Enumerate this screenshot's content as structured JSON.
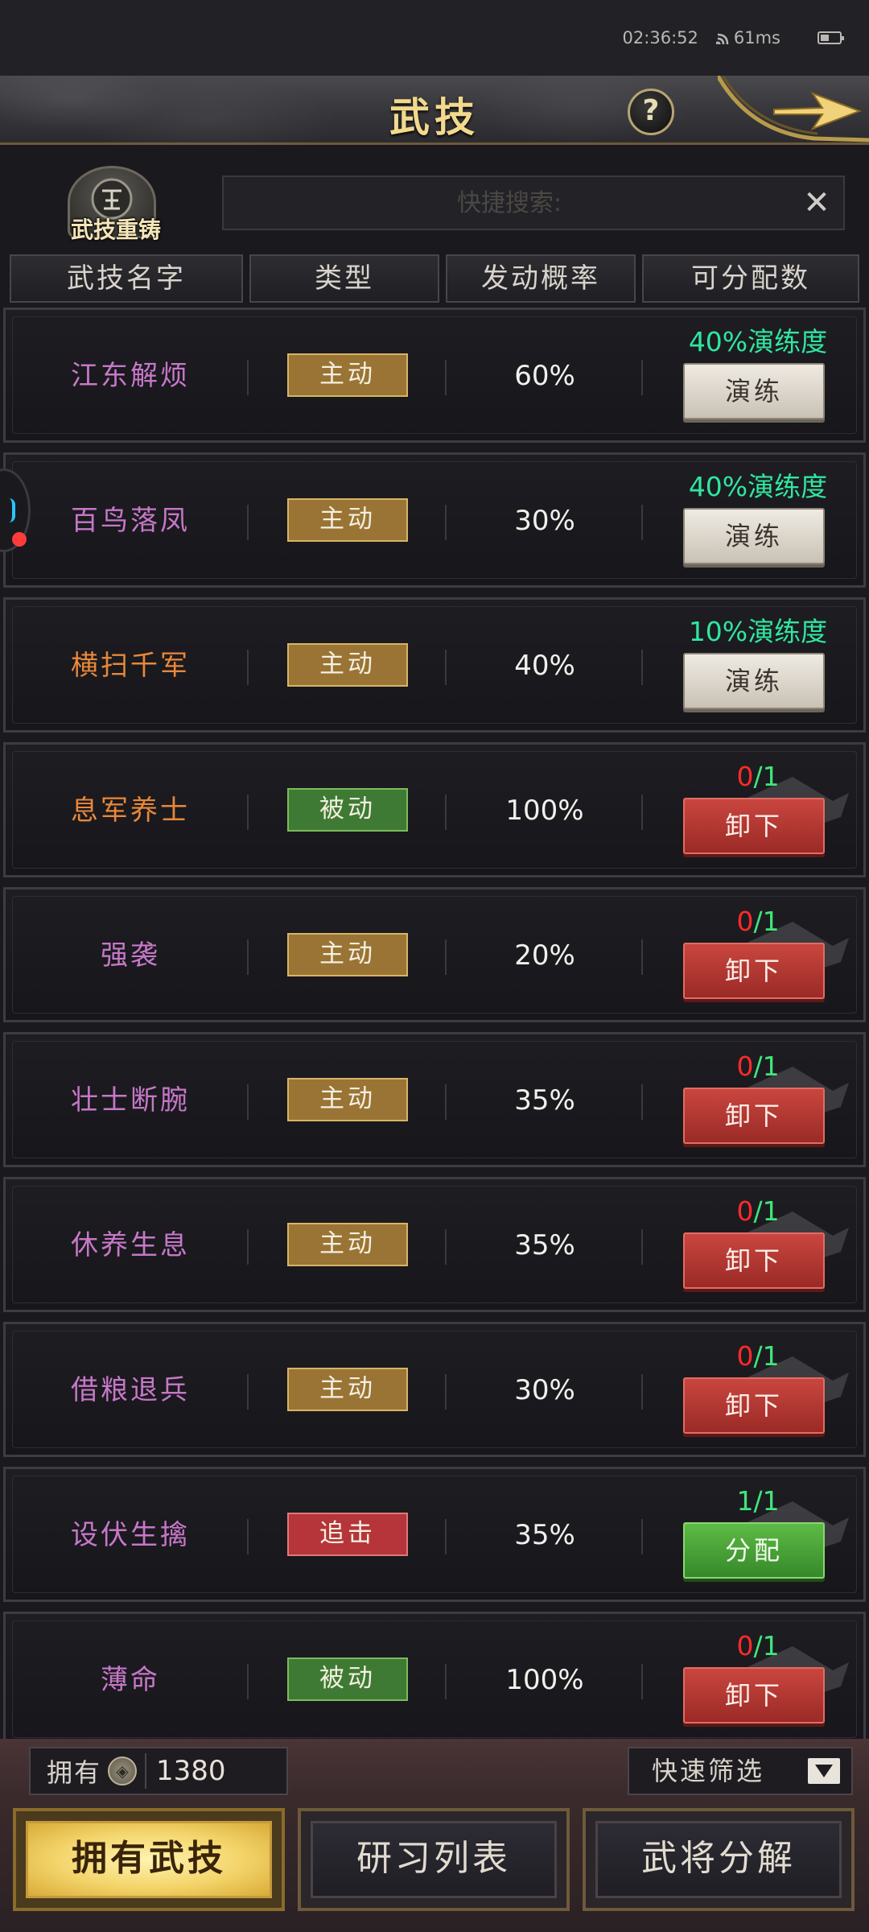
{
  "status": {
    "time": "02:36:52",
    "ping": "61ms"
  },
  "header": {
    "title": "武技",
    "help_label": "?"
  },
  "reforge": {
    "label": "武技重铸"
  },
  "search": {
    "placeholder": "快捷搜索:",
    "clear_label": "✕"
  },
  "columns": [
    "武技名字",
    "类型",
    "发动概率",
    "可分配数"
  ],
  "skills": [
    {
      "name": "江东解烦",
      "name_color": "#c678c8",
      "type": "主动",
      "type_kind": "active",
      "prob": "60%",
      "count_text": "40%演练度",
      "action": "演练",
      "action_kind": "practice"
    },
    {
      "name": "百鸟落凤",
      "name_color": "#c678c8",
      "type": "主动",
      "type_kind": "active",
      "prob": "30%",
      "count_text": "40%演练度",
      "action": "演练",
      "action_kind": "practice"
    },
    {
      "name": "横扫千军",
      "name_color": "#e8883a",
      "type": "主动",
      "type_kind": "active",
      "prob": "40%",
      "count_text": "10%演练度",
      "action": "演练",
      "action_kind": "practice"
    },
    {
      "name": "息军养士",
      "name_color": "#e8883a",
      "type": "被动",
      "type_kind": "passive",
      "prob": "100%",
      "count_used": "0",
      "count_total": "1",
      "action": "卸下",
      "action_kind": "unload"
    },
    {
      "name": "强袭",
      "name_color": "#c678c8",
      "type": "主动",
      "type_kind": "active",
      "prob": "20%",
      "count_used": "0",
      "count_total": "1",
      "action": "卸下",
      "action_kind": "unload"
    },
    {
      "name": "壮士断腕",
      "name_color": "#c678c8",
      "type": "主动",
      "type_kind": "active",
      "prob": "35%",
      "count_used": "0",
      "count_total": "1",
      "action": "卸下",
      "action_kind": "unload"
    },
    {
      "name": "休养生息",
      "name_color": "#c678c8",
      "type": "主动",
      "type_kind": "active",
      "prob": "35%",
      "count_used": "0",
      "count_total": "1",
      "action": "卸下",
      "action_kind": "unload"
    },
    {
      "name": "借粮退兵",
      "name_color": "#c678c8",
      "type": "主动",
      "type_kind": "active",
      "prob": "30%",
      "count_used": "0",
      "count_total": "1",
      "action": "卸下",
      "action_kind": "unload"
    },
    {
      "name": "设伏生擒",
      "name_color": "#c678c8",
      "type": "追击",
      "type_kind": "chase",
      "prob": "35%",
      "count_used": "1",
      "count_total": "1",
      "action": "分配",
      "action_kind": "assign"
    },
    {
      "name": "薄命",
      "name_color": "#c678c8",
      "type": "被动",
      "type_kind": "passive",
      "prob": "100%",
      "count_used": "0",
      "count_total": "1",
      "action": "卸下",
      "action_kind": "unload"
    }
  ],
  "bottom": {
    "owned_label": "拥有",
    "owned_value": "1380",
    "filter_label": "快速筛选",
    "tabs": [
      "拥有武技",
      "研习列表",
      "武将分解"
    ],
    "selected_tab": 0
  },
  "colors": {
    "accent_gold": "#f2d98c",
    "practice_green": "#2fe7a0",
    "zero_red": "#ff2a2a",
    "assigned_green": "#3fe67a"
  }
}
